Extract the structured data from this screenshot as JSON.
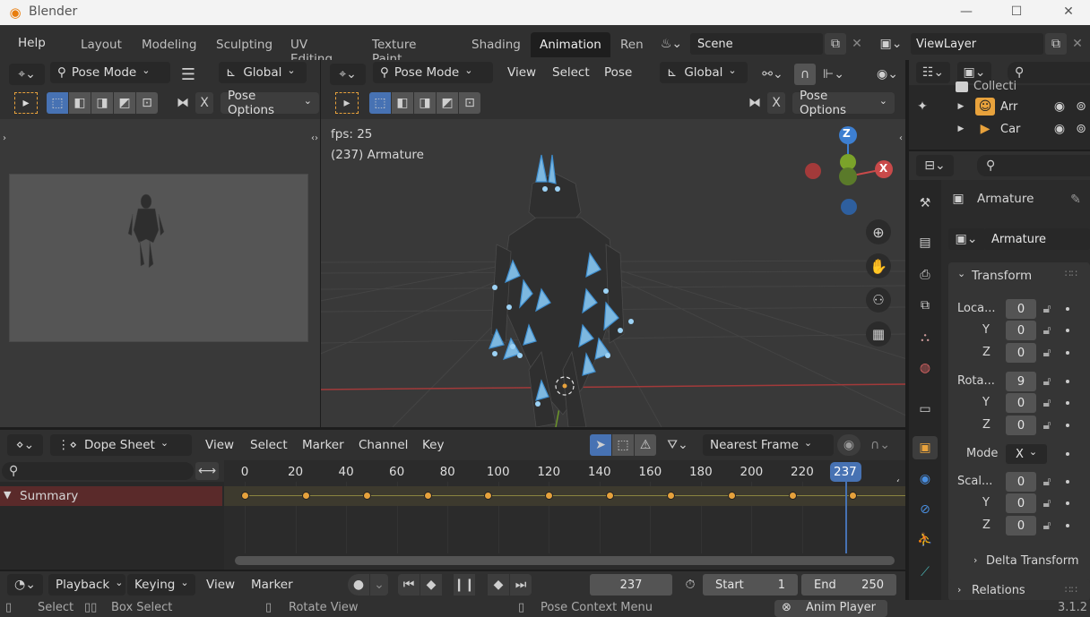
{
  "window": {
    "title": "Blender",
    "minimize": "—",
    "maximize": "☐",
    "close": "✕"
  },
  "menus": {
    "help": "Help"
  },
  "workspaces": [
    "Layout",
    "Modeling",
    "Sculpting",
    "UV Editing",
    "Texture Paint",
    "Shading",
    "Animation",
    "Ren"
  ],
  "scene": {
    "name": "Scene",
    "view_layer": "ViewLayer"
  },
  "left_view": {
    "mode": "Pose Mode",
    "orientation": "Global",
    "pose_options": "Pose Options",
    "x_label": "X"
  },
  "viewport": {
    "mode": "Pose Mode",
    "menus": [
      "View",
      "Select",
      "Pose"
    ],
    "orientation": "Global",
    "pose_options": "Pose Options",
    "x_label": "X",
    "fps": "fps: 25",
    "object_info": "(237) Armature",
    "gizmo": {
      "z": "Z",
      "x": "X"
    }
  },
  "outliner": {
    "items": [
      "Collecti",
      "Arr",
      "Car"
    ]
  },
  "properties": {
    "object_name": "Armature",
    "data_name": "Armature",
    "transform_header": "Transform",
    "location_label": "Loca...",
    "rotation_label": "Rota...",
    "scale_label": "Scal...",
    "y": "Y",
    "z": "Z",
    "location": [
      "0",
      "0",
      "0"
    ],
    "rotation": [
      "9",
      "0",
      "0"
    ],
    "scale": [
      "0",
      "0",
      "0"
    ],
    "mode_label": "Mode",
    "mode_value": "X",
    "delta_transform": "Delta Transform",
    "relations": "Relations"
  },
  "dopesheet": {
    "editor": "Dope Sheet",
    "menus": [
      "View",
      "Select",
      "Marker",
      "Channel",
      "Key"
    ],
    "snap": "Nearest Frame",
    "summary": "Summary",
    "ticks": [
      "0",
      "20",
      "40",
      "60",
      "80",
      "100",
      "120",
      "140",
      "160",
      "180",
      "200",
      "220"
    ],
    "current_frame": "237",
    "keyframes": [
      0,
      24,
      48,
      72,
      96,
      120,
      144,
      168,
      192,
      216,
      240
    ],
    "frame_start": 0,
    "frame_end": 240
  },
  "timeline": {
    "playback": "Playback",
    "keying": "Keying",
    "view": "View",
    "marker": "Marker",
    "frame": "237",
    "start_label": "Start",
    "start": "1",
    "end_label": "End",
    "end": "250"
  },
  "status": {
    "select": "Select",
    "box_select": "Box Select",
    "rotate": "Rotate View",
    "pose_menu": "Pose Context Menu",
    "anim_player": "Anim Player",
    "version": "3.1.2"
  },
  "colors": {
    "accent": "#4772b3",
    "keyframe": "#e6a23c",
    "summary_row": "#5a2a2a",
    "axis_x": "#c94a4a",
    "axis_z": "#3d7fd1",
    "axis_y": "#6f9a2a"
  }
}
